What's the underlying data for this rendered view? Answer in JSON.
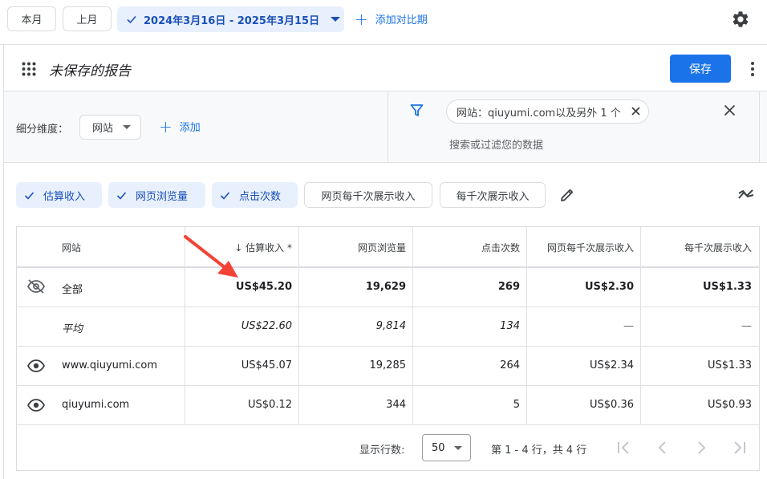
{
  "topbar": {
    "this_month": "本月",
    "last_month": "上月",
    "date_range": "2024年3月16日 - 2025年3月15日",
    "add_compare": "添加对比期",
    "accent": "#1a73e8"
  },
  "report": {
    "title": "未保存的报告",
    "save": "保存"
  },
  "breakdown": {
    "label": "细分维度：",
    "selected": "网站",
    "add": "添加"
  },
  "filter": {
    "chip": "网站：qiuyumi.com以及另外 1 个",
    "search_placeholder": "搜索或过滤您的数据"
  },
  "metrics": {
    "selected": [
      "估算收入",
      "网页浏览量",
      "点击次数"
    ],
    "unselected": [
      "网页每千次展示收入",
      "每千次展示收入"
    ]
  },
  "table": {
    "headers": {
      "site": "网站",
      "revenue": "↓ 估算收入 *",
      "pageviews": "网页浏览量",
      "clicks": "点击次数",
      "page_rpm": "网页每千次展示收入",
      "rpm": "每千次展示收入"
    },
    "total": {
      "site": "全部",
      "revenue": "US$45.20",
      "pageviews": "19,629",
      "clicks": "269",
      "page_rpm": "US$2.30",
      "rpm": "US$1.33"
    },
    "average": {
      "site": "平均",
      "revenue": "US$22.60",
      "pageviews": "9,814",
      "clicks": "134",
      "page_rpm": "—",
      "rpm": "—"
    },
    "rows": [
      {
        "site": "www.qiuyumi.com",
        "revenue": "US$45.07",
        "pageviews": "19,285",
        "clicks": "264",
        "page_rpm": "US$2.34",
        "rpm": "US$1.33"
      },
      {
        "site": "qiuyumi.com",
        "revenue": "US$0.12",
        "pageviews": "344",
        "clicks": "5",
        "page_rpm": "US$0.36",
        "rpm": "US$0.93"
      }
    ]
  },
  "pagination": {
    "rows_label": "显示行数:",
    "rows_value": "50",
    "range": "第 1 - 4 行，共 4 行"
  },
  "annotation": {
    "arrow_color": "#f44336"
  }
}
